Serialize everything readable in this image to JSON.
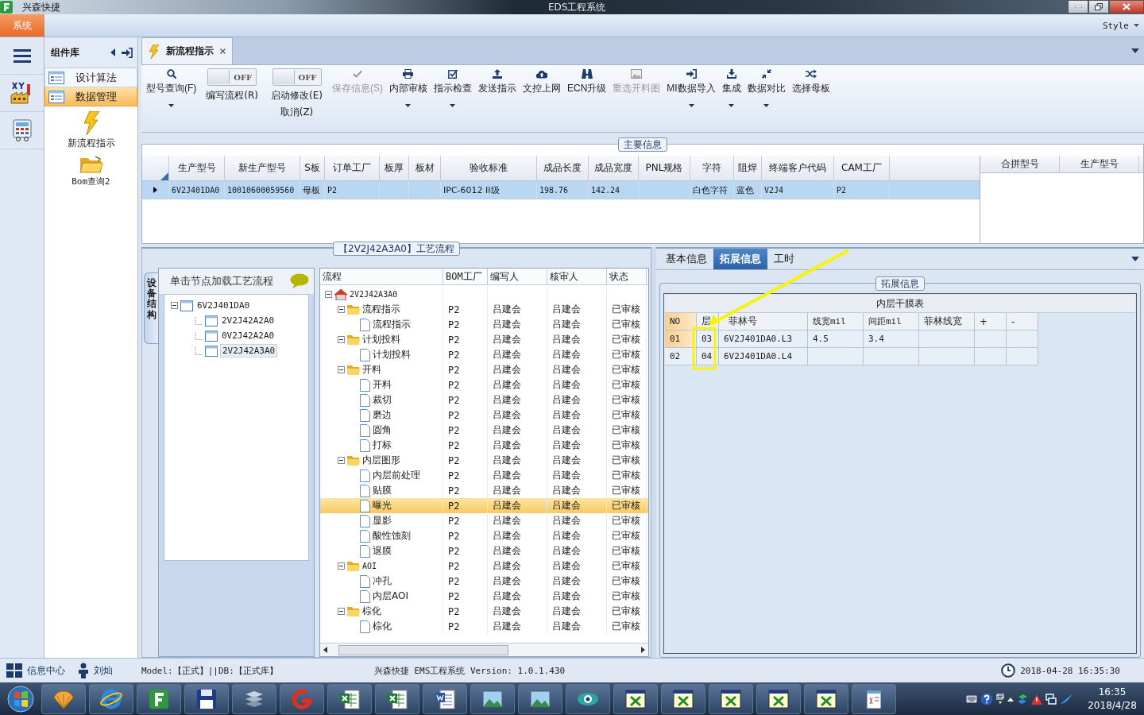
{
  "title_bar": {
    "app_name": "兴森快捷",
    "title": "EDS工程系统"
  },
  "menu_bar": {
    "tabs": [
      {
        "label": "系统",
        "selected": true
      }
    ],
    "style_label": "Style"
  },
  "component_panel": {
    "title": "组件库",
    "groups": [
      {
        "label": "设计算法",
        "selected": false
      },
      {
        "label": "数据管理",
        "selected": true
      }
    ],
    "items": [
      {
        "label": "新流程指示",
        "kind": "lightning"
      },
      {
        "label": "Bom查询2",
        "kind": "folder"
      }
    ]
  },
  "document_tabs": [
    {
      "label": "新流程指示",
      "selected": true
    }
  ],
  "ribbon": [
    {
      "kind": "button",
      "label": "型号查询(F)",
      "disabled": false,
      "dropdown": true
    },
    {
      "kind": "toggle",
      "label": "编写流程(R)",
      "switch_text": "OFF",
      "on": false
    },
    {
      "kind": "toggle",
      "label": "启动修改(E)",
      "sublabel": "取消(Z)",
      "switch_text": "OFF",
      "on": false
    },
    {
      "kind": "button",
      "label": "保存信息(S)",
      "disabled": true,
      "dropdown": false
    },
    {
      "kind": "button",
      "label": "内部审核",
      "disabled": false,
      "dropdown": true
    },
    {
      "kind": "button",
      "label": "指示检查",
      "disabled": false,
      "dropdown": true
    },
    {
      "kind": "button",
      "label": "发送指示",
      "disabled": false,
      "dropdown": false
    },
    {
      "kind": "button",
      "label": "文控上网",
      "disabled": false,
      "dropdown": false
    },
    {
      "kind": "button",
      "label": "ECN升级",
      "disabled": false,
      "dropdown": false
    },
    {
      "kind": "button",
      "label": "重选开料图",
      "disabled": true,
      "dropdown": false
    },
    {
      "kind": "button",
      "label": "MI数据导入",
      "disabled": false,
      "dropdown": true
    },
    {
      "kind": "button",
      "label": "集成",
      "disabled": false,
      "dropdown": true
    },
    {
      "kind": "button",
      "label": "数据对比",
      "disabled": false,
      "dropdown": true
    },
    {
      "kind": "button",
      "label": "选择母板",
      "disabled": false,
      "dropdown": false
    }
  ],
  "main_info": {
    "title": "主要信息",
    "columns": [
      "生产型号",
      "新生产型号",
      "S板",
      "订单工厂",
      "板厚",
      "板材",
      "验收标准",
      "成品长度",
      "成品宽度",
      "PNL规格",
      "字符",
      "阻焊",
      "终端客户代码",
      "CAM工厂"
    ],
    "rows": [
      {
        "selected": true,
        "cells": [
          "6V2J401DA0",
          "10010600059560",
          "母板",
          "P2",
          null,
          null,
          "IPC-6012 II级",
          "198.76",
          "142.24",
          null,
          "白色字符",
          "蓝色",
          "V2J4",
          "P2"
        ]
      }
    ],
    "side_columns": [
      "合拼型号",
      "生产型号"
    ]
  },
  "process": {
    "title": "【2V2J42A3A0】工艺流程",
    "side_tab": "设备结构",
    "hint": "单击节点加载工艺流程",
    "device_tree": [
      {
        "label": "6V2J401DA0",
        "selected": false,
        "expanded": true,
        "children": [
          {
            "label": "2V2J42A2A0",
            "selected": false
          },
          {
            "label": "0V2J42A2A0",
            "selected": false
          },
          {
            "label": "2V2J42A3A0",
            "selected": true
          }
        ]
      }
    ],
    "columns": [
      "流程",
      "BOM工厂",
      "编写人",
      "核审人",
      "状态"
    ],
    "flow": [
      {
        "kind": "root",
        "label": "2V2J42A3A0",
        "expanded": true,
        "selected": false,
        "children": [
          {
            "kind": "folder",
            "label": "流程指示",
            "bom": "P2",
            "author": "吕建会",
            "reviewer": "吕建会",
            "status": "已审核",
            "expanded": true,
            "selected": false,
            "children": [
              {
                "kind": "file",
                "label": "流程指示",
                "bom": "P2",
                "author": "吕建会",
                "reviewer": "吕建会",
                "status": "已审核",
                "selected": false
              }
            ]
          },
          {
            "kind": "folder",
            "label": "计划投料",
            "bom": "P2",
            "author": "吕建会",
            "reviewer": "吕建会",
            "status": "已审核",
            "expanded": true,
            "selected": false,
            "children": [
              {
                "kind": "file",
                "label": "计划投料",
                "bom": "P2",
                "author": "吕建会",
                "reviewer": "吕建会",
                "status": "已审核",
                "selected": false
              }
            ]
          },
          {
            "kind": "folder",
            "label": "开料",
            "bom": "P2",
            "author": "吕建会",
            "reviewer": "吕建会",
            "status": "已审核",
            "expanded": true,
            "selected": false,
            "children": [
              {
                "kind": "file",
                "label": "开料",
                "bom": "P2",
                "author": "吕建会",
                "reviewer": "吕建会",
                "status": "已审核",
                "selected": false
              },
              {
                "kind": "file",
                "label": "裁切",
                "bom": "P2",
                "author": "吕建会",
                "reviewer": "吕建会",
                "status": "已审核",
                "selected": false
              },
              {
                "kind": "file",
                "label": "磨边",
                "bom": "P2",
                "author": "吕建会",
                "reviewer": "吕建会",
                "status": "已审核",
                "selected": false
              },
              {
                "kind": "file",
                "label": "圆角",
                "bom": "P2",
                "author": "吕建会",
                "reviewer": "吕建会",
                "status": "已审核",
                "selected": false
              },
              {
                "kind": "file",
                "label": "打标",
                "bom": "P2",
                "author": "吕建会",
                "reviewer": "吕建会",
                "status": "已审核",
                "selected": false
              }
            ]
          },
          {
            "kind": "folder",
            "label": "内层图形",
            "bom": "P2",
            "author": "吕建会",
            "reviewer": "吕建会",
            "status": "已审核",
            "expanded": true,
            "selected": false,
            "children": [
              {
                "kind": "file",
                "label": "内层前处理",
                "bom": "P2",
                "author": "吕建会",
                "reviewer": "吕建会",
                "status": "已审核",
                "selected": false
              },
              {
                "kind": "file",
                "label": "贴膜",
                "bom": "P2",
                "author": "吕建会",
                "reviewer": "吕建会",
                "status": "已审核",
                "selected": false
              },
              {
                "kind": "file",
                "label": "曝光",
                "bom": "P2",
                "author": "吕建会",
                "reviewer": "吕建会",
                "status": "已审核",
                "selected": true
              },
              {
                "kind": "file",
                "label": "显影",
                "bom": "P2",
                "author": "吕建会",
                "reviewer": "吕建会",
                "status": "已审核",
                "selected": false
              },
              {
                "kind": "file",
                "label": "酸性蚀刻",
                "bom": "P2",
                "author": "吕建会",
                "reviewer": "吕建会",
                "status": "已审核",
                "selected": false
              },
              {
                "kind": "file",
                "label": "退膜",
                "bom": "P2",
                "author": "吕建会",
                "reviewer": "吕建会",
                "status": "已审核",
                "selected": false
              }
            ]
          },
          {
            "kind": "folder",
            "label": "AOI",
            "bom": "P2",
            "author": "吕建会",
            "reviewer": "吕建会",
            "status": "已审核",
            "expanded": true,
            "selected": false,
            "children": [
              {
                "kind": "file",
                "label": "冲孔",
                "bom": "P2",
                "author": "吕建会",
                "reviewer": "吕建会",
                "status": "已审核",
                "selected": false
              },
              {
                "kind": "file",
                "label": "内层AOI",
                "bom": "P2",
                "author": "吕建会",
                "reviewer": "吕建会",
                "status": "已审核",
                "selected": false
              }
            ]
          },
          {
            "kind": "folder",
            "label": "棕化",
            "bom": "P2",
            "author": "吕建会",
            "reviewer": "吕建会",
            "status": "已审核",
            "expanded": true,
            "selected": false,
            "children": [
              {
                "kind": "file",
                "label": "棕化",
                "bom": "P2",
                "author": "吕建会",
                "reviewer": "吕建会",
                "status": "已审核",
                "selected": false
              }
            ]
          }
        ]
      }
    ]
  },
  "detail": {
    "tabs": [
      {
        "label": "基本信息",
        "selected": false
      },
      {
        "label": "拓展信息",
        "selected": true
      },
      {
        "label": "工时",
        "selected": false
      }
    ],
    "group_title": "拓展信息",
    "table_title": "内层干膜表",
    "columns": [
      "NO",
      "层",
      "菲林号",
      "线宽mil",
      "间距mil",
      "菲林线宽",
      "+",
      "-"
    ],
    "rows": [
      {
        "selected": true,
        "cells": [
          "01",
          "03",
          "6V2J401DA0.L3",
          "4.5",
          "3.4",
          null,
          null,
          null
        ]
      },
      {
        "selected": false,
        "cells": [
          "02",
          "04",
          "6V2J401DA0.L4",
          null,
          null,
          null,
          null,
          null
        ]
      }
    ]
  },
  "status_bar": {
    "info_center": "信息中心",
    "user": "刘灿",
    "model": "Model:【正式】||DB:【正式库】",
    "version": "兴森快捷 EMS工程系统 Version: 1.0.1.430",
    "datetime": "2018-04-28 16:35:30"
  },
  "taskbar": {
    "time": "16:35",
    "date": "2018/4/28"
  }
}
